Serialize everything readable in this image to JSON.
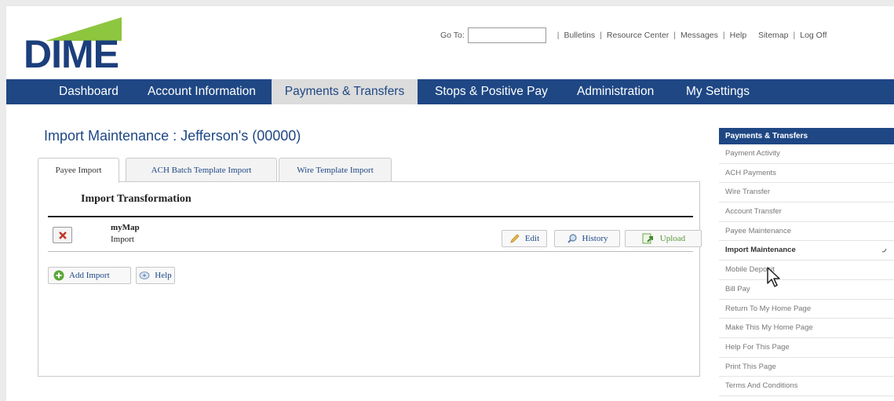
{
  "logo": {
    "text": "DIME"
  },
  "topbar": {
    "goto_label": "Go To:",
    "goto_value": "",
    "links": [
      "Bulletins",
      "Resource Center",
      "Messages",
      "Help",
      "Sitemap",
      "Log Off"
    ]
  },
  "nav": {
    "items": [
      "Dashboard",
      "Account Information",
      "Payments & Transfers",
      "Stops & Positive Pay",
      "Administration",
      "My Settings"
    ],
    "active": "Payments & Transfers"
  },
  "page_title": "Import Maintenance : Jefferson's (00000)",
  "tabs": [
    "Payee Import",
    "ACH Batch Template Import",
    "Wire Template Import"
  ],
  "section_title": "Import Transformation",
  "import_row": {
    "name": "myMap",
    "type": "Import",
    "edit_label": "Edit",
    "history_label": "History",
    "upload_label": "Upload"
  },
  "actions": {
    "add_import_label": "Add Import",
    "help_label": "Help"
  },
  "sidebar": {
    "title": "Payments & Transfers",
    "items": [
      "Payment Activity",
      "ACH Payments",
      "Wire Transfer",
      "Account Transfer",
      "Payee Maintenance",
      "Import Maintenance",
      "Mobile Deposit",
      "Bill Pay",
      "Return To My Home Page",
      "Make This My Home Page",
      "Help For This Page",
      "Print This Page",
      "Terms And Conditions"
    ]
  },
  "colors": {
    "brand_blue": "#1e4784",
    "logo_green": "#8dc63f",
    "upload_green": "#5a9a3a"
  }
}
